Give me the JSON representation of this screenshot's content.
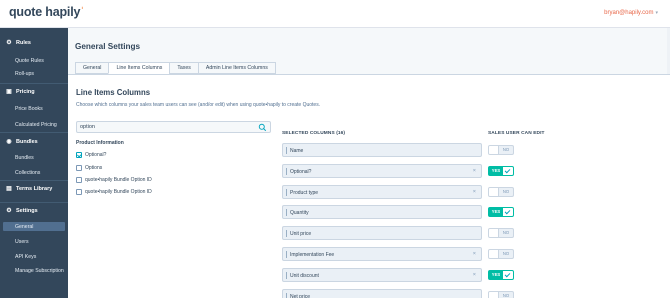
{
  "app": {
    "logo_text": "quote hapily",
    "user_email": "bryan@hapily.com"
  },
  "sidebar": {
    "sections": [
      {
        "title": "Rules",
        "icon": "gear-icon",
        "items": [
          "Quote Rules",
          "Roll-ups"
        ]
      },
      {
        "title": "Pricing",
        "icon": "pricing-icon",
        "items": [
          "Price Books",
          "Calculated Pricing"
        ]
      },
      {
        "title": "Bundles",
        "icon": "bundle-icon",
        "items": [
          "Bundles",
          "Collections"
        ]
      },
      {
        "title": "Terms Library",
        "icon": "book-icon",
        "items": []
      },
      {
        "title": "Settings",
        "icon": "gear-icon",
        "items": [
          "General",
          "Users",
          "API Keys",
          "Manage Subscription"
        ]
      }
    ],
    "active_item": "General"
  },
  "page": {
    "title": "General Settings"
  },
  "tabs": [
    "General",
    "Line Items Columns",
    "Taxes",
    "Admin Line Items Columns"
  ],
  "active_tab": "Line Items Columns",
  "section": {
    "title": "Line Items Columns",
    "description": "Choose which columns your sales team users can see (and/or edit) when using quote•hapily to create Quotes."
  },
  "search": {
    "value": "option"
  },
  "product_info": {
    "label": "Product Information",
    "options": [
      {
        "label": "Optional?",
        "checked": true
      },
      {
        "label": "Options",
        "checked": false
      },
      {
        "label": "quote•hapily Bundle Option ID",
        "checked": false
      },
      {
        "label": "quote•hapily Bundle Option ID",
        "checked": false
      }
    ]
  },
  "selected": {
    "header": "SELECTED COLUMNS (16)",
    "edit_header": "SALES USER CAN EDIT",
    "yes_label": "YES",
    "no_label": "NO",
    "remove_glyph": "×",
    "rows": [
      {
        "name": "Name",
        "removable": false,
        "can_edit": false
      },
      {
        "name": "Optional?",
        "removable": true,
        "can_edit": true
      },
      {
        "name": "Product type",
        "removable": true,
        "can_edit": false
      },
      {
        "name": "Quantity",
        "removable": false,
        "can_edit": true
      },
      {
        "name": "Unit price",
        "removable": false,
        "can_edit": false
      },
      {
        "name": "Implementation Fee",
        "removable": true,
        "can_edit": false
      },
      {
        "name": "Unit discount",
        "removable": true,
        "can_edit": true
      },
      {
        "name": "Net price",
        "removable": false,
        "can_edit": false
      }
    ]
  }
}
